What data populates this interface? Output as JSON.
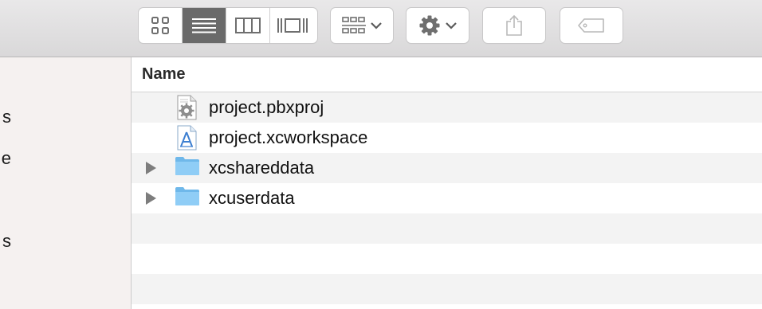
{
  "toolbar": {
    "view_buttons": [
      {
        "icon": "icon-view-icon",
        "active": false
      },
      {
        "icon": "list-view-icon",
        "active": true
      },
      {
        "icon": "column-view-icon",
        "active": false
      },
      {
        "icon": "cover-flow-view-icon",
        "active": false
      }
    ],
    "arrange_icon": "arrange-grid-icon",
    "action_icon": "gear-icon",
    "share_icon": "share-icon",
    "tag_icon": "tag-icon",
    "colors": {
      "active_segment": "#6a6a6a",
      "icon": "#6f6f6f"
    }
  },
  "sidebar": {
    "items": [
      {
        "label": "s"
      },
      {
        "label": "e"
      },
      {
        "label": "s"
      }
    ]
  },
  "list": {
    "column_header": "Name",
    "rows": [
      {
        "name": "project.pbxproj",
        "type": "pbxproj-file",
        "expandable": false
      },
      {
        "name": "project.xcworkspace",
        "type": "xcworkspace-file",
        "expandable": false
      },
      {
        "name": "xcshareddata",
        "type": "folder",
        "expandable": true
      },
      {
        "name": "xcuserdata",
        "type": "folder",
        "expandable": true
      }
    ]
  }
}
